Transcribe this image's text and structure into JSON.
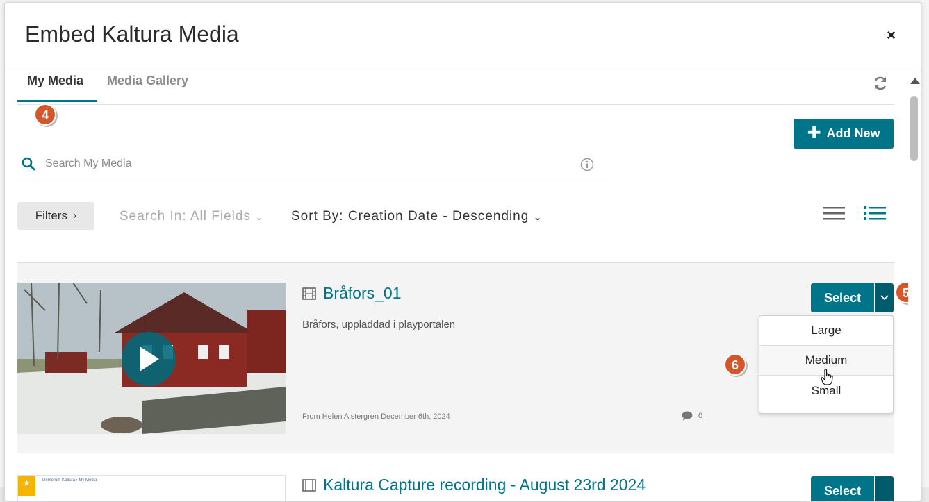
{
  "modal": {
    "title": "Embed Kaltura Media",
    "close_label": "×"
  },
  "tabs": [
    {
      "label": "My Media",
      "active": true
    },
    {
      "label": "Media Gallery",
      "active": false
    }
  ],
  "badges": {
    "step4": "4",
    "step5": "5",
    "step6": "6"
  },
  "toolbar": {
    "add_new_label": "Add New",
    "filters_label": "Filters",
    "search_in_label": "Search In: All Fields",
    "sort_by_label": "Sort By: Creation Date - Descending"
  },
  "search": {
    "placeholder": "Search My Media",
    "value": ""
  },
  "entries": [
    {
      "title": "Bråfors_01",
      "description": "Bråfors, uppladdad i playportalen",
      "meta": "From Helen Alstergren December 6th, 2024",
      "comments": "0",
      "select_label": "Select",
      "size_options": [
        "Large",
        "Medium",
        "Small"
      ]
    },
    {
      "title": "Kaltura Capture recording - August 23rd 2024",
      "select_label": "Select",
      "thumb_breadcrumb": "Demorum Kaltura  ›  My Media"
    }
  ],
  "colors": {
    "accent": "#00758a",
    "accent_dark": "#005b6c",
    "badge": "#d6562b"
  }
}
